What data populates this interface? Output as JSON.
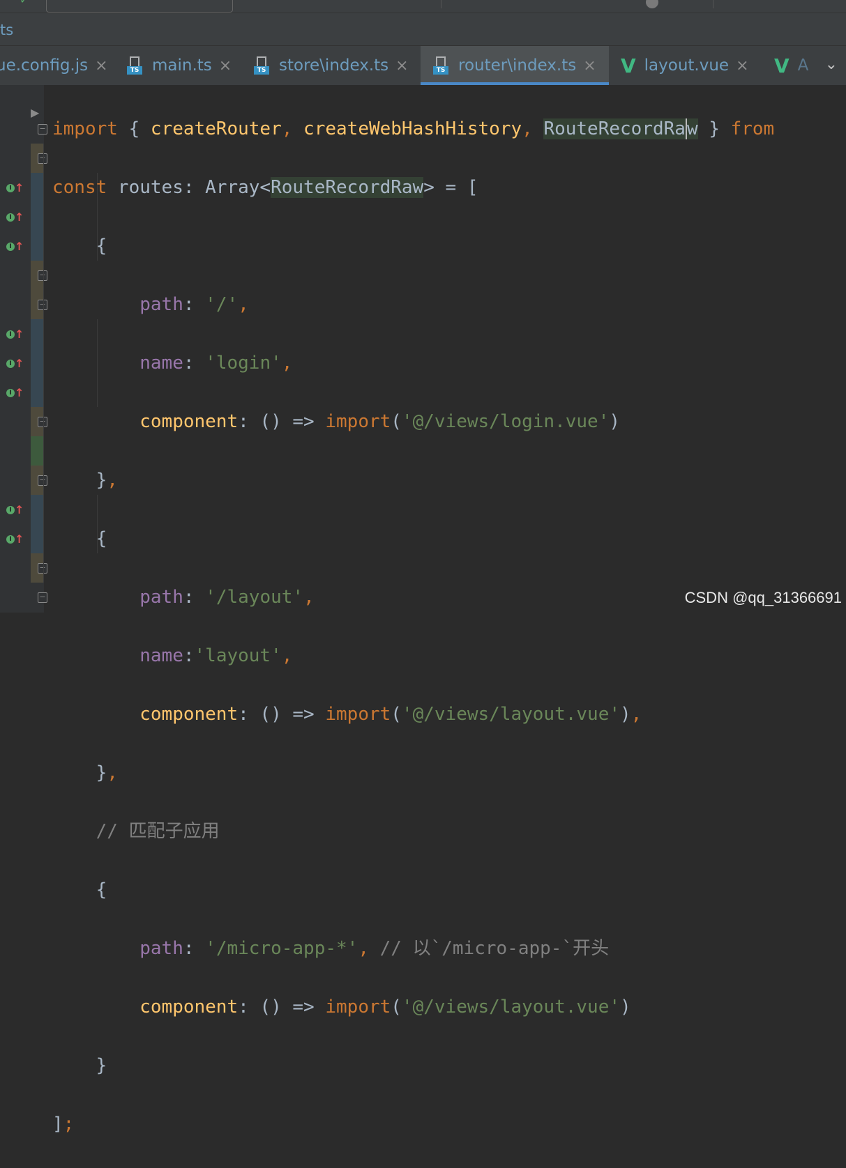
{
  "breadcrumb": "ts",
  "tabs": [
    {
      "label": "ue.config.js",
      "icon": "none",
      "active": false
    },
    {
      "label": "main.ts",
      "icon": "ts-icon",
      "active": false
    },
    {
      "label": "store\\index.ts",
      "icon": "ts-icon",
      "active": false
    },
    {
      "label": "router\\index.ts",
      "icon": "ts-icon",
      "active": true
    },
    {
      "label": "layout.vue",
      "icon": "vue-icon",
      "active": false
    },
    {
      "label": "A",
      "icon": "vue-icon",
      "active": false
    }
  ],
  "icon_text": {
    "ts": "TS",
    "vue": "V",
    "close": "×",
    "more": "⌄",
    "fold": "−",
    "impl": "I",
    "impl_arrow": "↑"
  },
  "code": {
    "l1": {
      "import": "import",
      "open": " { ",
      "createRouter": "createRouter",
      "c1": ", ",
      "createWebHashHistory": "createWebHashHistory",
      "c2": ", ",
      "rr_a": "RouteRecordRa",
      "rr_b": "w",
      "close": " } ",
      "from": "from"
    },
    "l2": {
      "const": "const",
      "rest": " routes: Array<",
      "type": "RouteRecordRaw",
      "end": "> = ["
    },
    "brace_open": "{",
    "brace_close_comma": "},",
    "brace_close": "}",
    "path_key": "path",
    "name_key": "name",
    "component_key": "component",
    "colon_sp": ": ",
    "colon": ":",
    "comma": ",",
    "arrow": "() => ",
    "import": "import",
    "paren_open": "(",
    "paren_close": ")",
    "r1": {
      "path": "'/'",
      "name": "'login'",
      "component": "'@/views/login.vue'"
    },
    "r2": {
      "path": "'/layout'",
      "name": "'layout'",
      "component": "'@/views/layout.vue'"
    },
    "comment_match": "// 匹配子应用",
    "r3": {
      "path": "'/micro-app-*'",
      "comment": "// 以`/micro-app-`开头",
      "component": "'@/views/layout.vue'"
    },
    "end_bracket": "]",
    "end_semi": ";"
  },
  "watermark": "CSDN @qq_31366691",
  "colors": {
    "keyword": "#cc7832",
    "function": "#ffc66d",
    "string": "#6a8759",
    "property": "#9876aa",
    "comment": "#808080",
    "tab_underline": "#4a88c7",
    "vue": "#41b883"
  }
}
